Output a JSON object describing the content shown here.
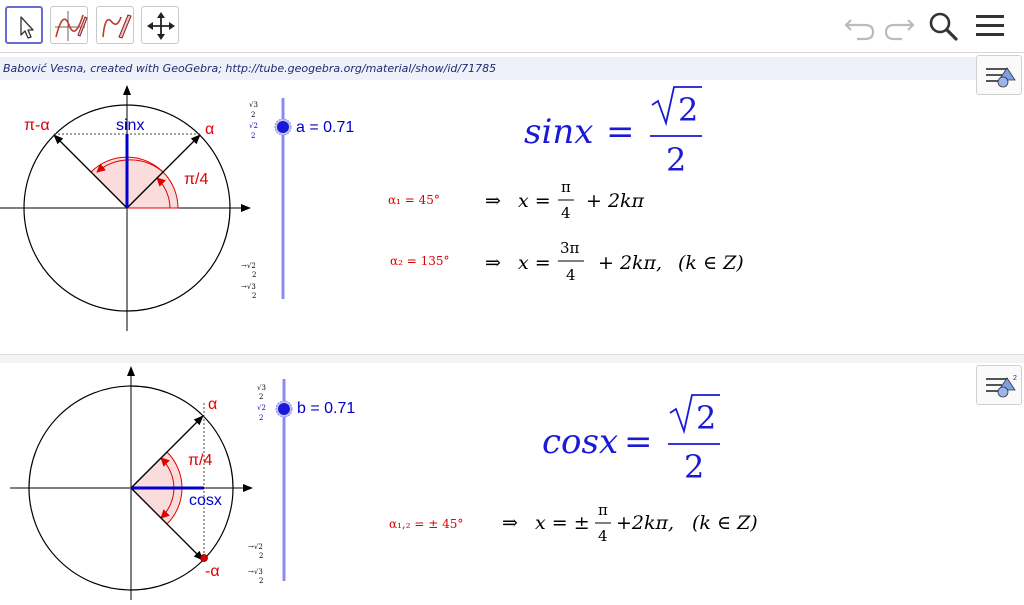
{
  "toolbar": {
    "tools": [
      {
        "name": "move-tool",
        "icon": "arrow-cursor-icon",
        "active": true
      },
      {
        "name": "function-tool",
        "icon": "function-pen-icon"
      },
      {
        "name": "freehand-tool",
        "icon": "freehand-pen-icon"
      },
      {
        "name": "pan-tool",
        "icon": "move-arrows-icon"
      }
    ],
    "right_icons": [
      "undo-icon",
      "redo-icon",
      "search-icon",
      "menu-icon"
    ]
  },
  "credit": "Babović Vesna, created with GeoGebra; http://tube.geogebra.org/material/show/id/71785",
  "panel_top": {
    "labels": {
      "pi_minus_alpha": "π-α",
      "sinx": "sinx",
      "alpha": "α",
      "pi_over_4": "π/4"
    },
    "slider": {
      "label": "a = 0.71",
      "value": 0.71,
      "min_label": "√2/2",
      "max_label": "√3/2"
    },
    "formula_lhs": "sinx",
    "formula_eq": "=",
    "formula_root": "2",
    "formula_den": "2",
    "alpha1": "α₁ = 45°",
    "alpha2": "α₂ = 135°",
    "impl": "⇒",
    "x_eq": "x =",
    "pi": "π",
    "three_pi": "3π",
    "four": "4",
    "plus_2kpi": "+  2kπ",
    "plus_2kpi_comma": "+  2kπ,",
    "k_in_z": "(k ∈ Z)"
  },
  "panel_bottom": {
    "labels": {
      "alpha": "α",
      "pi_over_4": "π/4",
      "cosx": "cosx",
      "minus_alpha": "-α"
    },
    "slider": {
      "label": "b = 0.71",
      "value": 0.71,
      "min_label": "√2/2",
      "max_label": "√3/2"
    },
    "formula_lhs": "cosx",
    "formula_eq": "=",
    "formula_root": "2",
    "formula_den": "2",
    "alpha12": "α₁,₂ = ± 45°",
    "impl": "⇒",
    "x_eq": "x = ±",
    "pi": "π",
    "four": "4",
    "plus_2kpi": "+2kπ,",
    "k_in_z": "(k ∈ Z)"
  },
  "colors": {
    "red": "#e00000",
    "blue": "#0000cc",
    "formula_blue": "#1a1ad6",
    "slider": "#8c8cf0"
  }
}
